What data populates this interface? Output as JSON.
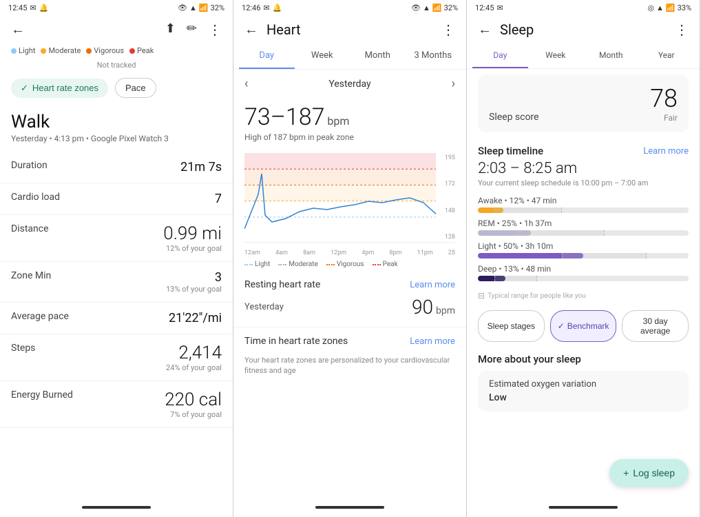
{
  "panel1": {
    "status": {
      "time": "12:45",
      "battery": "32%"
    },
    "back": "←",
    "legend": [
      {
        "label": "Light",
        "color": "#90caf9"
      },
      {
        "label": "Moderate",
        "color": "#ffa726"
      },
      {
        "label": "Vigorous",
        "color": "#ef6c00"
      },
      {
        "label": "Peak",
        "color": "#e53935"
      }
    ],
    "not_tracked": "Not tracked",
    "btn_zones": "Heart rate zones",
    "btn_pace": "Pace",
    "activity": "Walk",
    "subtitle": "Yesterday • 4:13 pm • Google Pixel Watch 3",
    "metrics": [
      {
        "label": "Duration",
        "value": "21m 7s",
        "sub": ""
      },
      {
        "label": "Cardio load",
        "value": "7",
        "sub": ""
      },
      {
        "label": "Distance",
        "value": "0.99 mi",
        "sub": "12% of your goal"
      },
      {
        "label": "Zone Min",
        "value": "3",
        "sub": "13% of your goal"
      },
      {
        "label": "Average pace",
        "value": "21'22\"/mi",
        "sub": ""
      },
      {
        "label": "Steps",
        "value": "2,414",
        "sub": "24% of your goal"
      },
      {
        "label": "Energy Burned",
        "value": "220 cal",
        "sub": "7% of your goal"
      }
    ]
  },
  "panel2": {
    "status": {
      "time": "12:46",
      "battery": "32%"
    },
    "title": "Heart",
    "tabs": [
      "Day",
      "Week",
      "Month",
      "3 Months"
    ],
    "active_tab": 0,
    "nav_prev": "‹",
    "nav_next": "›",
    "nav_label": "Yesterday",
    "bpm_range": "73–187",
    "bpm_unit": "bpm",
    "bpm_sub": "High of 187 bpm in peak zone",
    "chart_labels_y": [
      "195",
      "172",
      "148",
      "128"
    ],
    "chart_labels_x": [
      "12am",
      "4am",
      "8am",
      "12pm",
      "4pm",
      "8pm",
      "11pm"
    ],
    "chart_value": "25",
    "zone_legend": [
      {
        "label": "Light",
        "color": "#90caf9",
        "style": "dotted"
      },
      {
        "label": "Moderate",
        "color": "#aaa",
        "style": "dotted"
      },
      {
        "label": "Vigorous",
        "color": "#ef6c00",
        "style": "dotted"
      },
      {
        "label": "Peak",
        "color": "#e53935",
        "style": "dotted"
      }
    ],
    "resting_label": "Resting heart rate",
    "learn_more": "Learn more",
    "yesterday_label": "Yesterday",
    "rhr_value": "90",
    "rhr_unit": "bpm",
    "zones_label": "Time in heart rate zones",
    "learn_more2": "Learn more",
    "zones_note": "Your heart rate zones are personalized to your cardiovascular fitness and age"
  },
  "panel3": {
    "status": {
      "time": "12:45",
      "battery": "33%"
    },
    "title": "Sleep",
    "tabs": [
      "Day",
      "Week",
      "Month",
      "Year"
    ],
    "active_tab": 0,
    "sleep_score_label": "Sleep score",
    "sleep_score": "78",
    "sleep_score_sub": "Fair",
    "timeline_label": "Sleep timeline",
    "learn_more": "Learn more",
    "sleep_time": "2:03 – 8:25 am",
    "schedule": "Your current sleep schedule is 10:00 pm – 7:00 am",
    "stages": [
      {
        "label": "Awake • 12% • 47 min",
        "color": "#f5a623",
        "pct": 12
      },
      {
        "label": "REM • 25% • 1h 37m",
        "color": "#b8b8d0",
        "pct": 25
      },
      {
        "label": "Light • 50% • 3h 10m",
        "color": "#7c5cbf",
        "pct": 50
      },
      {
        "label": "Deep • 13% • 48 min",
        "color": "#2d1b5e",
        "pct": 13
      }
    ],
    "typical_label": "Typical range for people like you",
    "btn_stages": "Sleep stages",
    "btn_benchmark": "Benchmark",
    "btn_30day": "30 day average",
    "active_btn": 1,
    "more_label": "More about your sleep",
    "oxygen_title": "Estimated oxygen variation",
    "oxygen_value": "Low",
    "log_sleep": "Log sleep"
  }
}
